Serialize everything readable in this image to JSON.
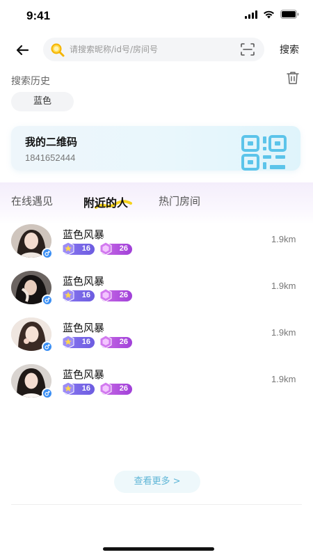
{
  "status_bar": {
    "time": "9:41"
  },
  "search": {
    "placeholder": "请搜索昵称/id号/房间号",
    "value": "",
    "button_label": "搜索"
  },
  "history": {
    "title": "搜索历史",
    "items": [
      "蓝色"
    ]
  },
  "qr_card": {
    "title": "我的二维码",
    "id": "1841652444"
  },
  "tabs": [
    {
      "label": "在线遇见",
      "active": false
    },
    {
      "label": "附近的人",
      "active": true
    },
    {
      "label": "热门房间",
      "active": false
    }
  ],
  "users": [
    {
      "name": "蓝色风暴",
      "level": "16",
      "wealth": "26",
      "distance": "1.9km",
      "gender": "male"
    },
    {
      "name": "蓝色风暴",
      "level": "16",
      "wealth": "26",
      "distance": "1.9km",
      "gender": "male"
    },
    {
      "name": "蓝色风暴",
      "level": "16",
      "wealth": "26",
      "distance": "1.9km",
      "gender": "male"
    },
    {
      "name": "蓝色风暴",
      "level": "16",
      "wealth": "26",
      "distance": "1.9km",
      "gender": "male"
    }
  ],
  "more_button": "查看更多 >",
  "colors": {
    "accent_tab_underline": "#f5d21a",
    "qr_blue": "#5cc4ea",
    "level_badge": "#7a68ea",
    "wealth_badge": "#b558e0",
    "gender_male": "#3b8ff4",
    "more_text": "#5db5d6"
  }
}
